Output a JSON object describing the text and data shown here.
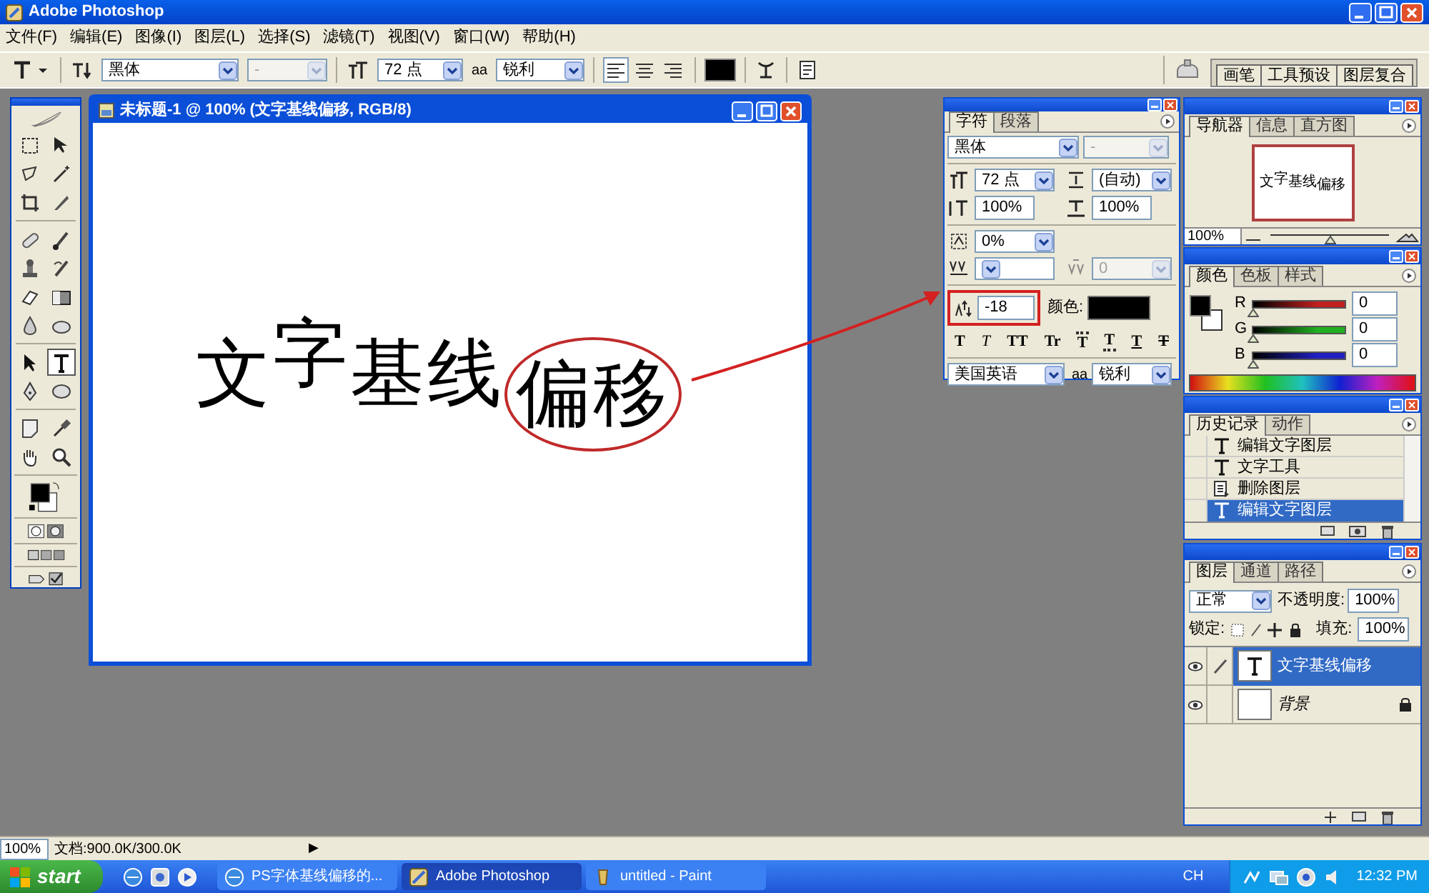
{
  "window": {
    "title": "Adobe Photoshop"
  },
  "menu": [
    "文件(F)",
    "编辑(E)",
    "图像(I)",
    "图层(L)",
    "选择(S)",
    "滤镜(T)",
    "视图(V)",
    "窗口(W)",
    "帮助(H)"
  ],
  "options_bar": {
    "font": "黑体",
    "style": "-",
    "size": "72 点",
    "aa": "aa",
    "antialias": "锐利",
    "align": [
      {
        "selected": true
      },
      {
        "selected": false
      },
      {
        "selected": false
      }
    ],
    "palette_tabs": [
      "画笔",
      "工具预设",
      "图层复合"
    ]
  },
  "toolbox": {
    "tools": [
      {
        "selected": false
      },
      {
        "selected": false
      },
      {
        "selected": false
      },
      {
        "selected": false
      },
      {
        "selected": false
      },
      {
        "selected": false
      },
      {
        "selected": false
      },
      {
        "selected": false
      },
      {
        "selected": false
      },
      {
        "selected": false
      },
      {
        "selected": false
      },
      {
        "selected": false
      },
      {
        "selected": false
      },
      {
        "selected": false
      },
      {
        "selected": false
      },
      {
        "selected": true
      },
      {
        "selected": false
      },
      {
        "selected": false
      },
      {
        "selected": false
      },
      {
        "selected": false
      },
      {
        "selected": false
      },
      {
        "selected": false
      }
    ]
  },
  "document": {
    "title": "未标题-1 @ 100% (文字基线偏移, RGB/8)",
    "segments": [
      {
        "text": "文",
        "kind": "normal",
        "circled": false
      },
      {
        "text": "字",
        "kind": "raised",
        "circled": false
      },
      {
        "text": "基线",
        "kind": "normal",
        "circled": false
      },
      {
        "text": "偏移",
        "kind": "lowered",
        "circled": true
      }
    ]
  },
  "character_panel": {
    "tabs": [
      {
        "label": "字符",
        "selected": true
      },
      {
        "label": "段落",
        "selected": false
      }
    ],
    "font": "黑体",
    "style": "-",
    "size": "72 点",
    "leading": "(自动)",
    "vertical_scale": "100%",
    "horizontal_scale": "100%",
    "tsume": "0%",
    "tracking": "0",
    "baseline_shift": "-18",
    "color_label": "颜色:",
    "styles": [
      {
        "label": "T",
        "kind": "bold"
      },
      {
        "label": "T",
        "kind": "italic"
      },
      {
        "label": "TT",
        "kind": "caps"
      },
      {
        "label": "Tr",
        "kind": "smallcaps"
      },
      {
        "label": "T",
        "kind": "super"
      },
      {
        "label": "T",
        "kind": "sub"
      },
      {
        "label": "T",
        "kind": "underline"
      },
      {
        "label": "T",
        "kind": "strike"
      }
    ],
    "language": "美国英语",
    "aa": "aa",
    "antialias": "锐利"
  },
  "navigator_panel": {
    "tabs": [
      {
        "label": "导航器",
        "selected": true
      },
      {
        "label": "信息",
        "selected": false
      },
      {
        "label": "直方图",
        "selected": false
      }
    ],
    "thumbnail_segments": [
      {
        "text": "文",
        "kind": "normal"
      },
      {
        "text": "字",
        "kind": "raised"
      },
      {
        "text": "基线",
        "kind": "normal"
      },
      {
        "text": "偏移",
        "kind": "lowered"
      }
    ],
    "zoom": "100%",
    "level": 0.5
  },
  "color_panel": {
    "tabs": [
      {
        "label": "颜色",
        "selected": true
      },
      {
        "label": "色板",
        "selected": false
      },
      {
        "label": "样式",
        "selected": false
      }
    ],
    "channels": [
      {
        "name": "R",
        "color": "#c02020",
        "level": 0,
        "value": "0"
      },
      {
        "name": "G",
        "color": "#20b020",
        "level": 0,
        "value": "0"
      },
      {
        "name": "B",
        "color": "#2020c0",
        "level": 0,
        "value": "0"
      }
    ]
  },
  "history_panel": {
    "tabs": [
      {
        "label": "历史记录",
        "selected": true
      },
      {
        "label": "动作",
        "selected": false
      }
    ],
    "items": [
      {
        "label": "编辑文字图层",
        "kind": "type",
        "selected": false
      },
      {
        "label": "文字工具",
        "kind": "type",
        "selected": false
      },
      {
        "label": "删除图层",
        "kind": "delete",
        "selected": false
      },
      {
        "label": "编辑文字图层",
        "kind": "type",
        "selected": true
      }
    ]
  },
  "layers_panel": {
    "tabs": [
      {
        "label": "图层",
        "selected": true
      },
      {
        "label": "通道",
        "selected": false
      },
      {
        "label": "路径",
        "selected": false
      }
    ],
    "blend_mode": "正常",
    "opacity_label": "不透明度:",
    "opacity": "100%",
    "lock_label": "锁定:",
    "fill_label": "填充:",
    "fill": "100%",
    "layers": [
      {
        "name": "文字基线偏移",
        "kind": "type",
        "selected": true,
        "visible": true,
        "locked": false
      },
      {
        "name": "背景",
        "kind": "background",
        "selected": false,
        "visible": true,
        "locked": true
      }
    ]
  },
  "status_bar": {
    "zoom": "100%",
    "doc_size": "文档:900.0K/300.0K",
    "arrow": "▶"
  },
  "taskbar": {
    "start": "start",
    "tasks": [
      {
        "label": "PS字体基线偏移的...",
        "kind": "browser",
        "selected": false
      },
      {
        "label": "Adobe Photoshop",
        "kind": "photoshop",
        "selected": true
      },
      {
        "label": "untitled - Paint",
        "kind": "paint",
        "selected": false
      }
    ],
    "language": "CH",
    "clock": "12:32 PM"
  }
}
